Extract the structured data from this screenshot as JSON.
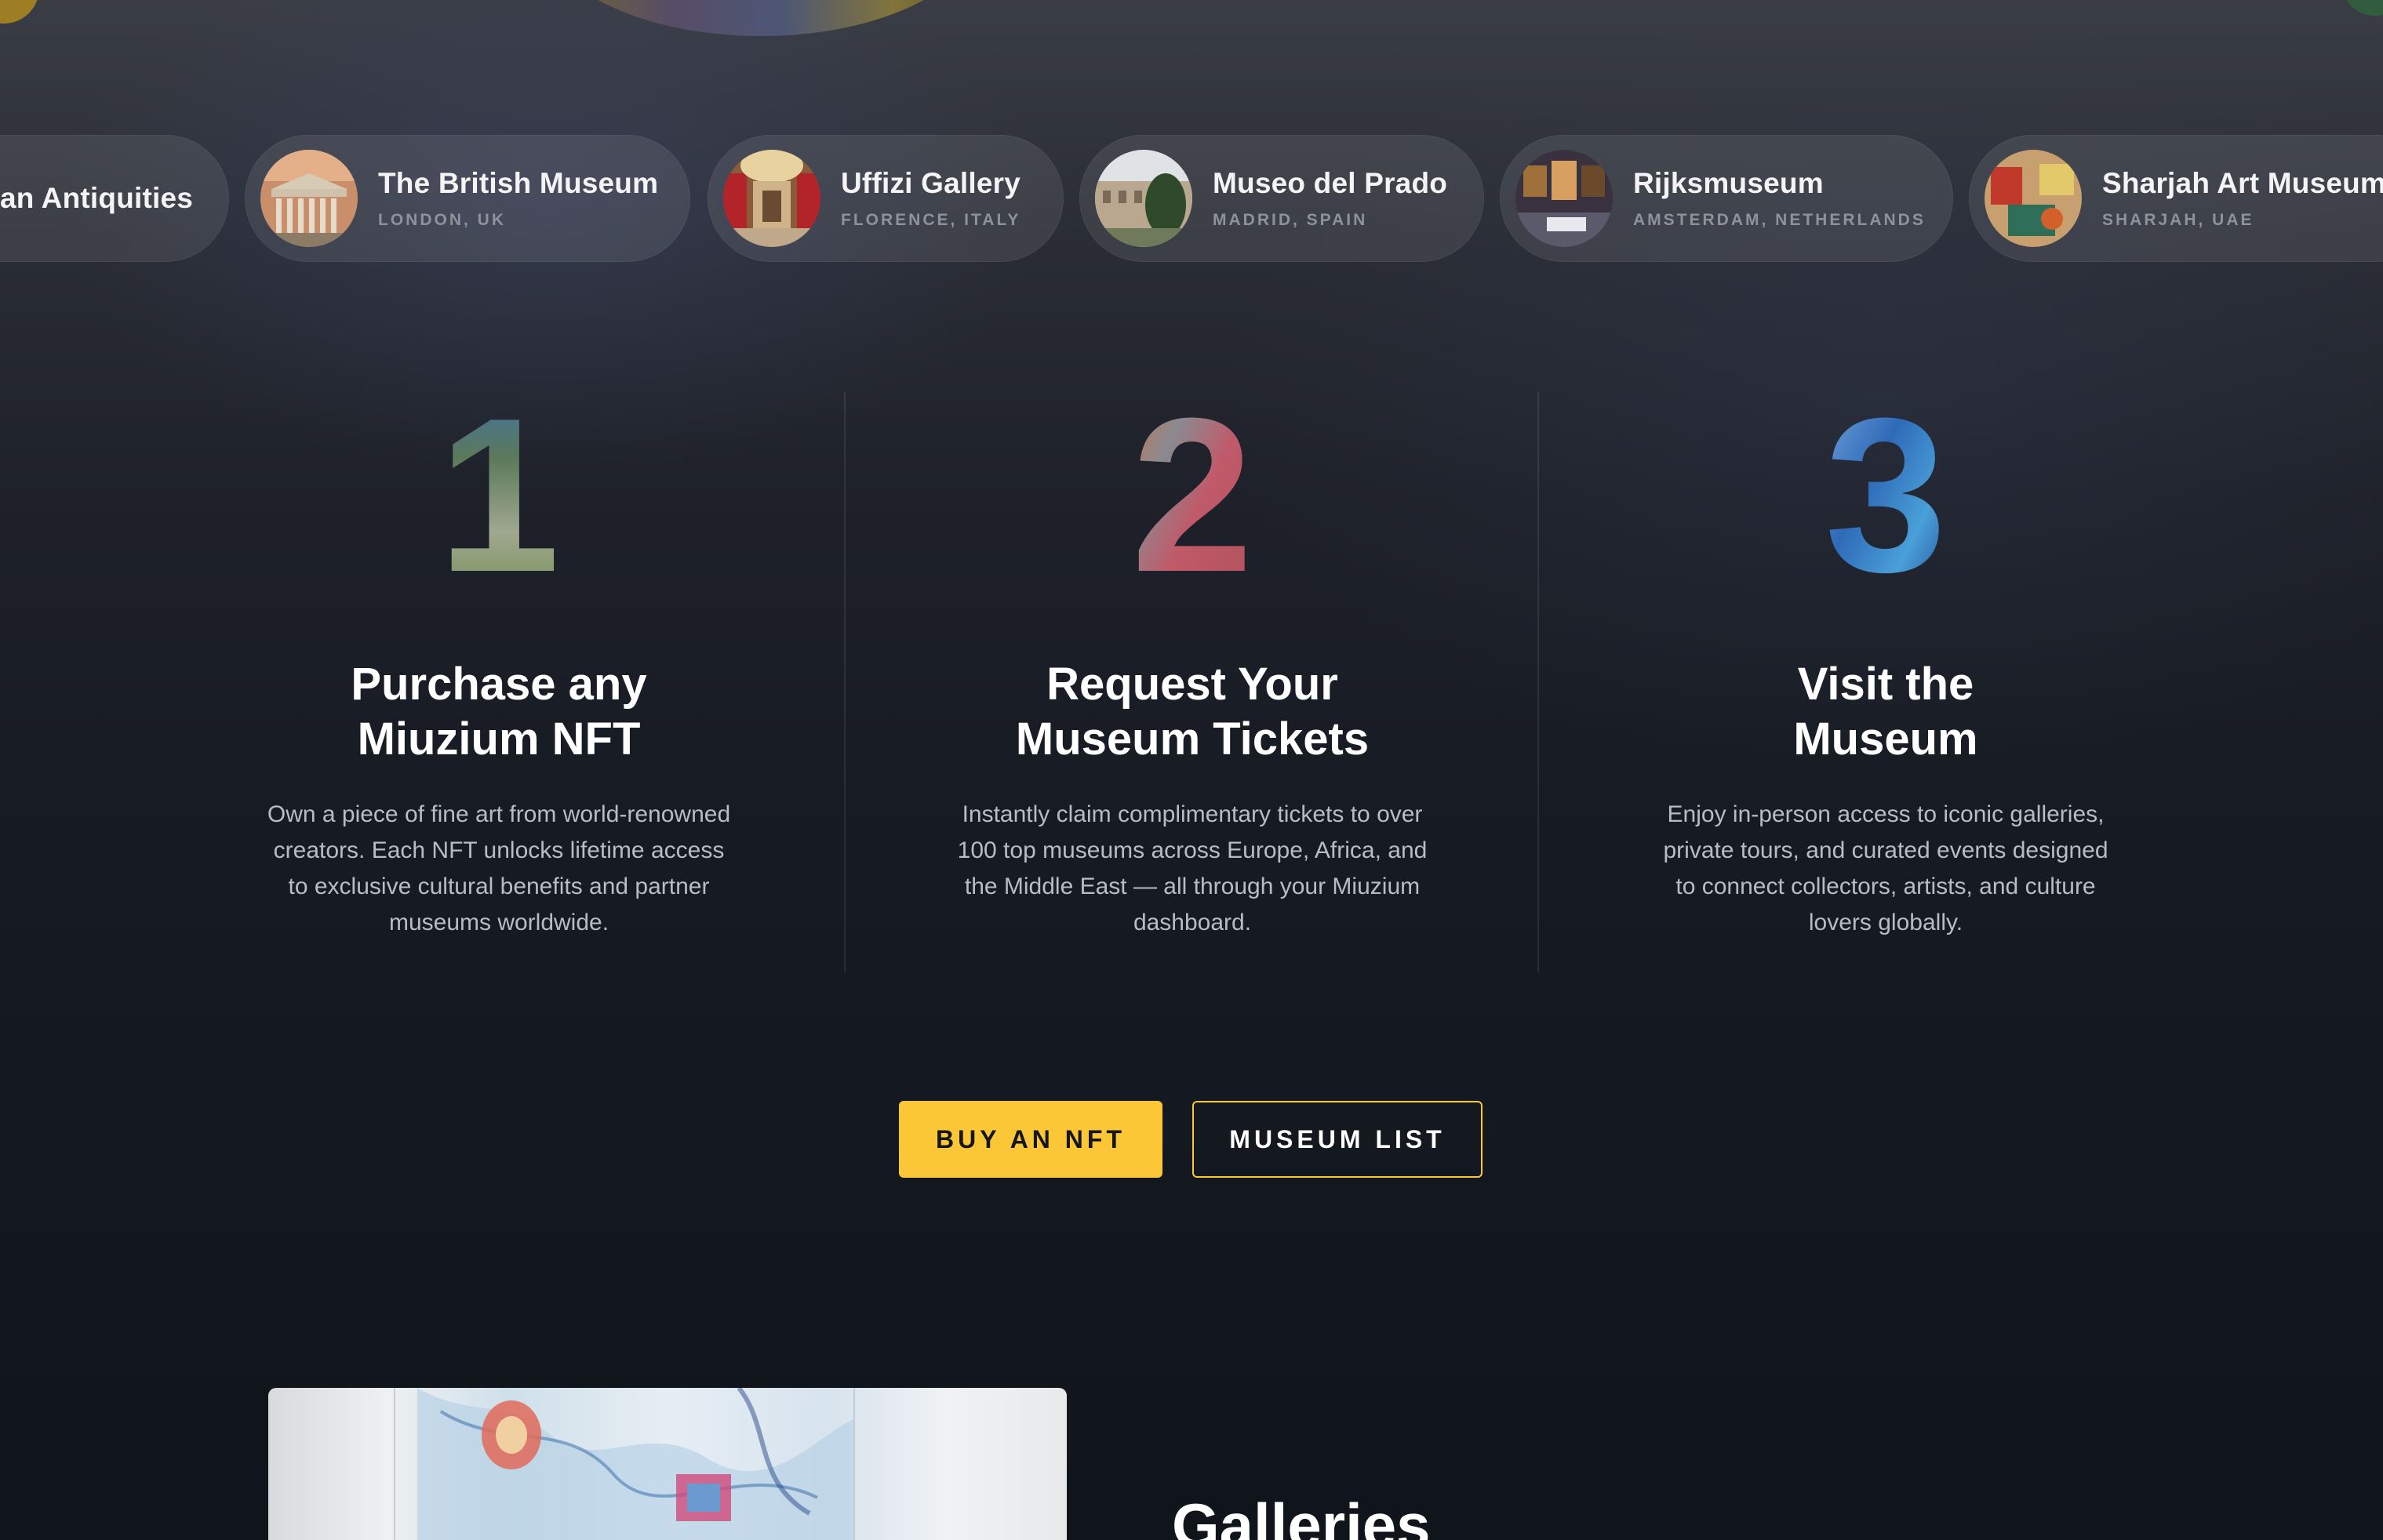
{
  "museums": [
    {
      "name": "an Antiquities",
      "location": ""
    },
    {
      "name": "The British Museum",
      "location": "LONDON, UK"
    },
    {
      "name": "Uffizi Gallery",
      "location": "FLORENCE, ITALY"
    },
    {
      "name": "Museo del Prado",
      "location": "MADRID, SPAIN"
    },
    {
      "name": "Rijksmuseum",
      "location": "AMSTERDAM, NETHERLANDS"
    },
    {
      "name": "Sharjah Art Museum",
      "location": "SHARJAH, UAE"
    }
  ],
  "steps": [
    {
      "number": "1",
      "title": "Purchase any\nMiuzium NFT",
      "description": "Own a piece of fine art from world-renowned creators. Each NFT unlocks lifetime access to exclusive cultural benefits and partner museums worldwide."
    },
    {
      "number": "2",
      "title": "Request Your\nMuseum Tickets",
      "description": "Instantly claim complimentary tickets to over 100 top museums across Europe, Africa, and the Middle East — all through your Miuzium dashboard."
    },
    {
      "number": "3",
      "title": "Visit the\nMuseum",
      "description": "Enjoy in-person access to iconic galleries, private tours, and curated events designed to connect collectors, artists, and culture lovers globally."
    }
  ],
  "buttons": {
    "buy": "BUY AN NFT",
    "museum_list": "MUSEUM LIST"
  },
  "galleries": {
    "title": "Galleries"
  },
  "colors": {
    "accent": "#fcc737",
    "background": "#12151c"
  }
}
